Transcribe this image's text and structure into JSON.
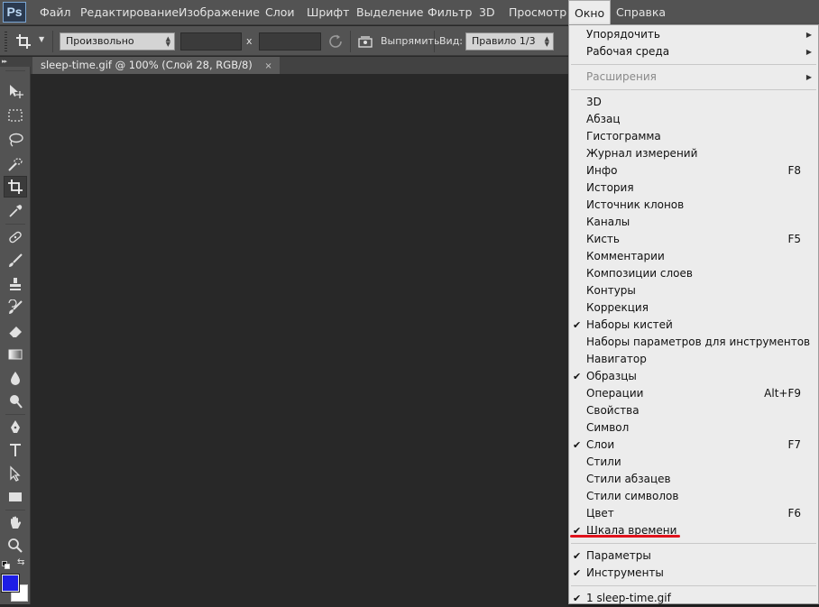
{
  "app": {
    "logo": "Ps"
  },
  "menubar": {
    "items": [
      "Файл",
      "Редактирование",
      "Изображение",
      "Слои",
      "Шрифт",
      "Выделение",
      "Фильтр",
      "3D",
      "Просмотр",
      "Окно",
      "Справка"
    ],
    "active": "Окно"
  },
  "options": {
    "tool_icon": "crop-icon",
    "preset_value": "Произвольно",
    "width_value": "",
    "height_value": "",
    "x_separator": "x",
    "straighten_label": "Выпрямить",
    "view_label": "Вид:",
    "view_value": "Правило 1/3"
  },
  "tools": {
    "header": "▸▸",
    "selected": "crop-tool",
    "foreground_color": "#1d1de6",
    "background_color": "#ffffff"
  },
  "document": {
    "tab_title": "sleep-time.gif @ 100% (Слой 28, RGB/8)",
    "close_glyph": "×"
  },
  "window_menu": {
    "items": [
      {
        "label": "Упорядочить",
        "submenu": true
      },
      {
        "label": "Рабочая среда",
        "submenu": true
      },
      {
        "separator": true
      },
      {
        "label": "Расширения",
        "submenu": true,
        "disabled": true
      },
      {
        "separator": true
      },
      {
        "label": "3D"
      },
      {
        "label": "Абзац"
      },
      {
        "label": "Гистограмма"
      },
      {
        "label": "Журнал измерений"
      },
      {
        "label": "Инфо",
        "shortcut": "F8"
      },
      {
        "label": "История"
      },
      {
        "label": "Источник клонов"
      },
      {
        "label": "Каналы"
      },
      {
        "label": "Кисть",
        "shortcut": "F5"
      },
      {
        "label": "Комментарии"
      },
      {
        "label": "Композиции слоев"
      },
      {
        "label": "Контуры"
      },
      {
        "label": "Коррекция"
      },
      {
        "label": "Наборы кистей",
        "checked": true
      },
      {
        "label": "Наборы параметров для инструментов"
      },
      {
        "label": "Навигатор"
      },
      {
        "label": "Образцы",
        "checked": true
      },
      {
        "label": "Операции",
        "shortcut": "Alt+F9"
      },
      {
        "label": "Свойства"
      },
      {
        "label": "Символ"
      },
      {
        "label": "Слои",
        "checked": true,
        "shortcut": "F7"
      },
      {
        "label": "Стили"
      },
      {
        "label": "Стили абзацев"
      },
      {
        "label": "Стили символов"
      },
      {
        "label": "Цвет",
        "shortcut": "F6"
      },
      {
        "label": "Шкала времени",
        "checked": true,
        "underlined": true,
        "underline_color": "#e0121c"
      },
      {
        "separator": true
      },
      {
        "label": "Параметры",
        "checked": true
      },
      {
        "label": "Инструменты",
        "checked": true
      },
      {
        "separator": true
      },
      {
        "label": "1 sleep-time.gif",
        "checked": true
      }
    ],
    "check_glyph": "✔",
    "submenu_glyph": "▶"
  }
}
